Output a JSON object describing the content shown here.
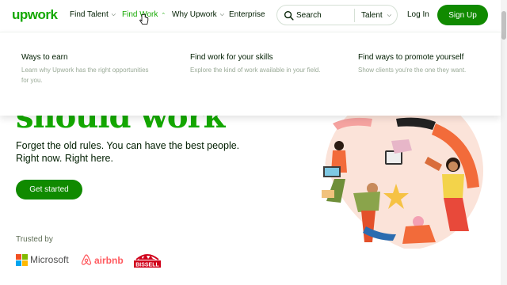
{
  "header": {
    "logo": "upwork",
    "nav": [
      {
        "label": "Find Talent",
        "chevron": "chevron-down-icon"
      },
      {
        "label": "Find Work",
        "chevron": "chevron-up-icon"
      },
      {
        "label": "Why Upwork",
        "chevron": "chevron-down-icon"
      },
      {
        "label": "Enterprise"
      }
    ],
    "search": {
      "placeholder": "Search",
      "category": "Talent"
    },
    "login": "Log In",
    "signup": "Sign Up"
  },
  "dropdown": {
    "items": [
      {
        "title": "Ways to earn",
        "desc": "Learn why Upwork has the right opportunities for you."
      },
      {
        "title": "Find work for your skills",
        "desc": "Explore the kind of work available in your field."
      },
      {
        "title": "Find ways to promote yourself",
        "desc": "Show clients you're the one they want."
      }
    ]
  },
  "hero": {
    "title_fragment": "should work",
    "subtitle": "Forget the old rules. You can have the best people. Right now. Right here.",
    "cta": "Get started"
  },
  "trusted": {
    "label": "Trusted by",
    "brands": [
      "Microsoft",
      "airbnb",
      "BISSELL"
    ]
  },
  "colors": {
    "brand_green": "#14a800",
    "button_green": "#108a00",
    "text_dark": "#001e00",
    "muted": "#9aaa97"
  }
}
